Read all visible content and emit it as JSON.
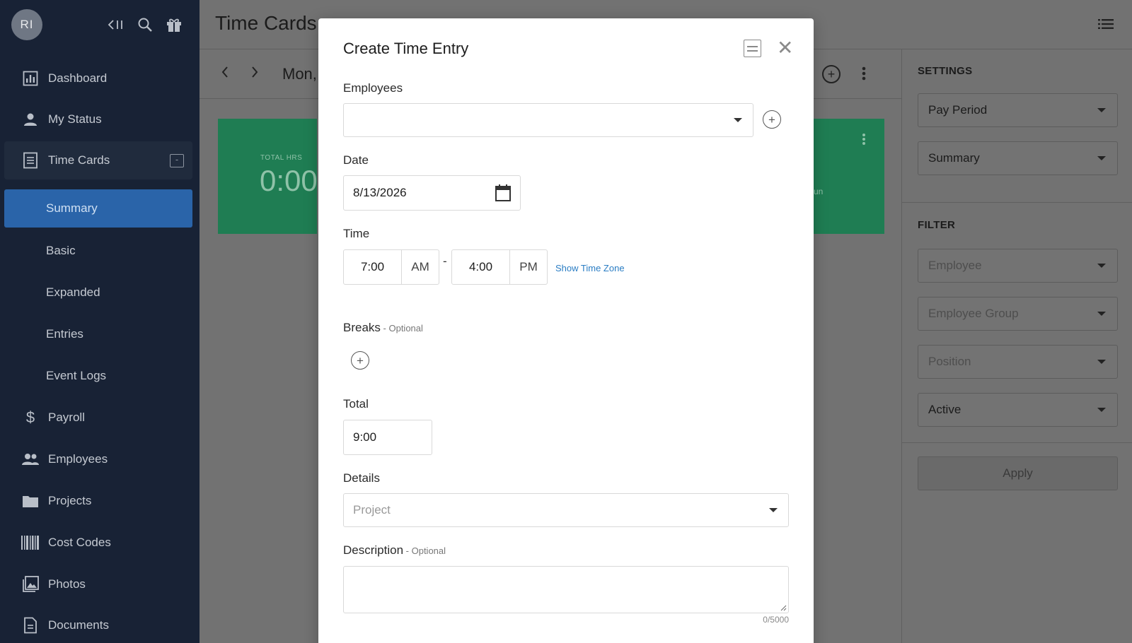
{
  "sidebar": {
    "avatar_initials": "RI",
    "items": [
      {
        "label": "Dashboard",
        "icon": "chart-icon"
      },
      {
        "label": "My Status",
        "icon": "person-icon"
      },
      {
        "label": "Time Cards",
        "icon": "document-icon"
      },
      {
        "label": "Payroll",
        "icon": "dollar-icon"
      },
      {
        "label": "Employees",
        "icon": "people-icon"
      },
      {
        "label": "Projects",
        "icon": "folder-icon"
      },
      {
        "label": "Cost Codes",
        "icon": "barcode-icon"
      },
      {
        "label": "Photos",
        "icon": "photos-icon"
      },
      {
        "label": "Documents",
        "icon": "file-icon"
      }
    ],
    "time_cards_sub": [
      "Summary",
      "Basic",
      "Expanded",
      "Entries",
      "Event Logs"
    ],
    "collapse_symbol": "-"
  },
  "header": {
    "title": "Time Cards"
  },
  "datebar": {
    "date_text": "Mon,"
  },
  "summary_card": {
    "total_label": "TOTAL HRS",
    "total_value": "0:00",
    "right_partial": "un"
  },
  "right_panel": {
    "settings_heading": "SETTINGS",
    "pay_period": "Pay Period",
    "view": "Summary",
    "filter_heading": "FILTER",
    "employee_placeholder": "Employee",
    "employee_group_placeholder": "Employee Group",
    "position_placeholder": "Position",
    "status": "Active",
    "apply_label": "Apply"
  },
  "modal": {
    "title": "Create Time Entry",
    "employees_label": "Employees",
    "date_label": "Date",
    "date_value": "8/13/2026",
    "time_label": "Time",
    "start_time": "7:00",
    "start_ampm": "AM",
    "dash": "-",
    "end_time": "4:00",
    "end_ampm": "PM",
    "show_time_zone": "Show Time Zone",
    "breaks_label": "Breaks",
    "breaks_optional": " - Optional",
    "total_label": "Total",
    "total_value": "9:00",
    "details_label": "Details",
    "project_placeholder": "Project",
    "description_label": "Description",
    "description_optional": " - Optional",
    "description_counter": "0/5000"
  },
  "colors": {
    "sidebar_bg": "#182235",
    "sidebar_active": "#2a64a9",
    "card_green": "#1f7d53",
    "link_blue": "#2a7dc4"
  }
}
